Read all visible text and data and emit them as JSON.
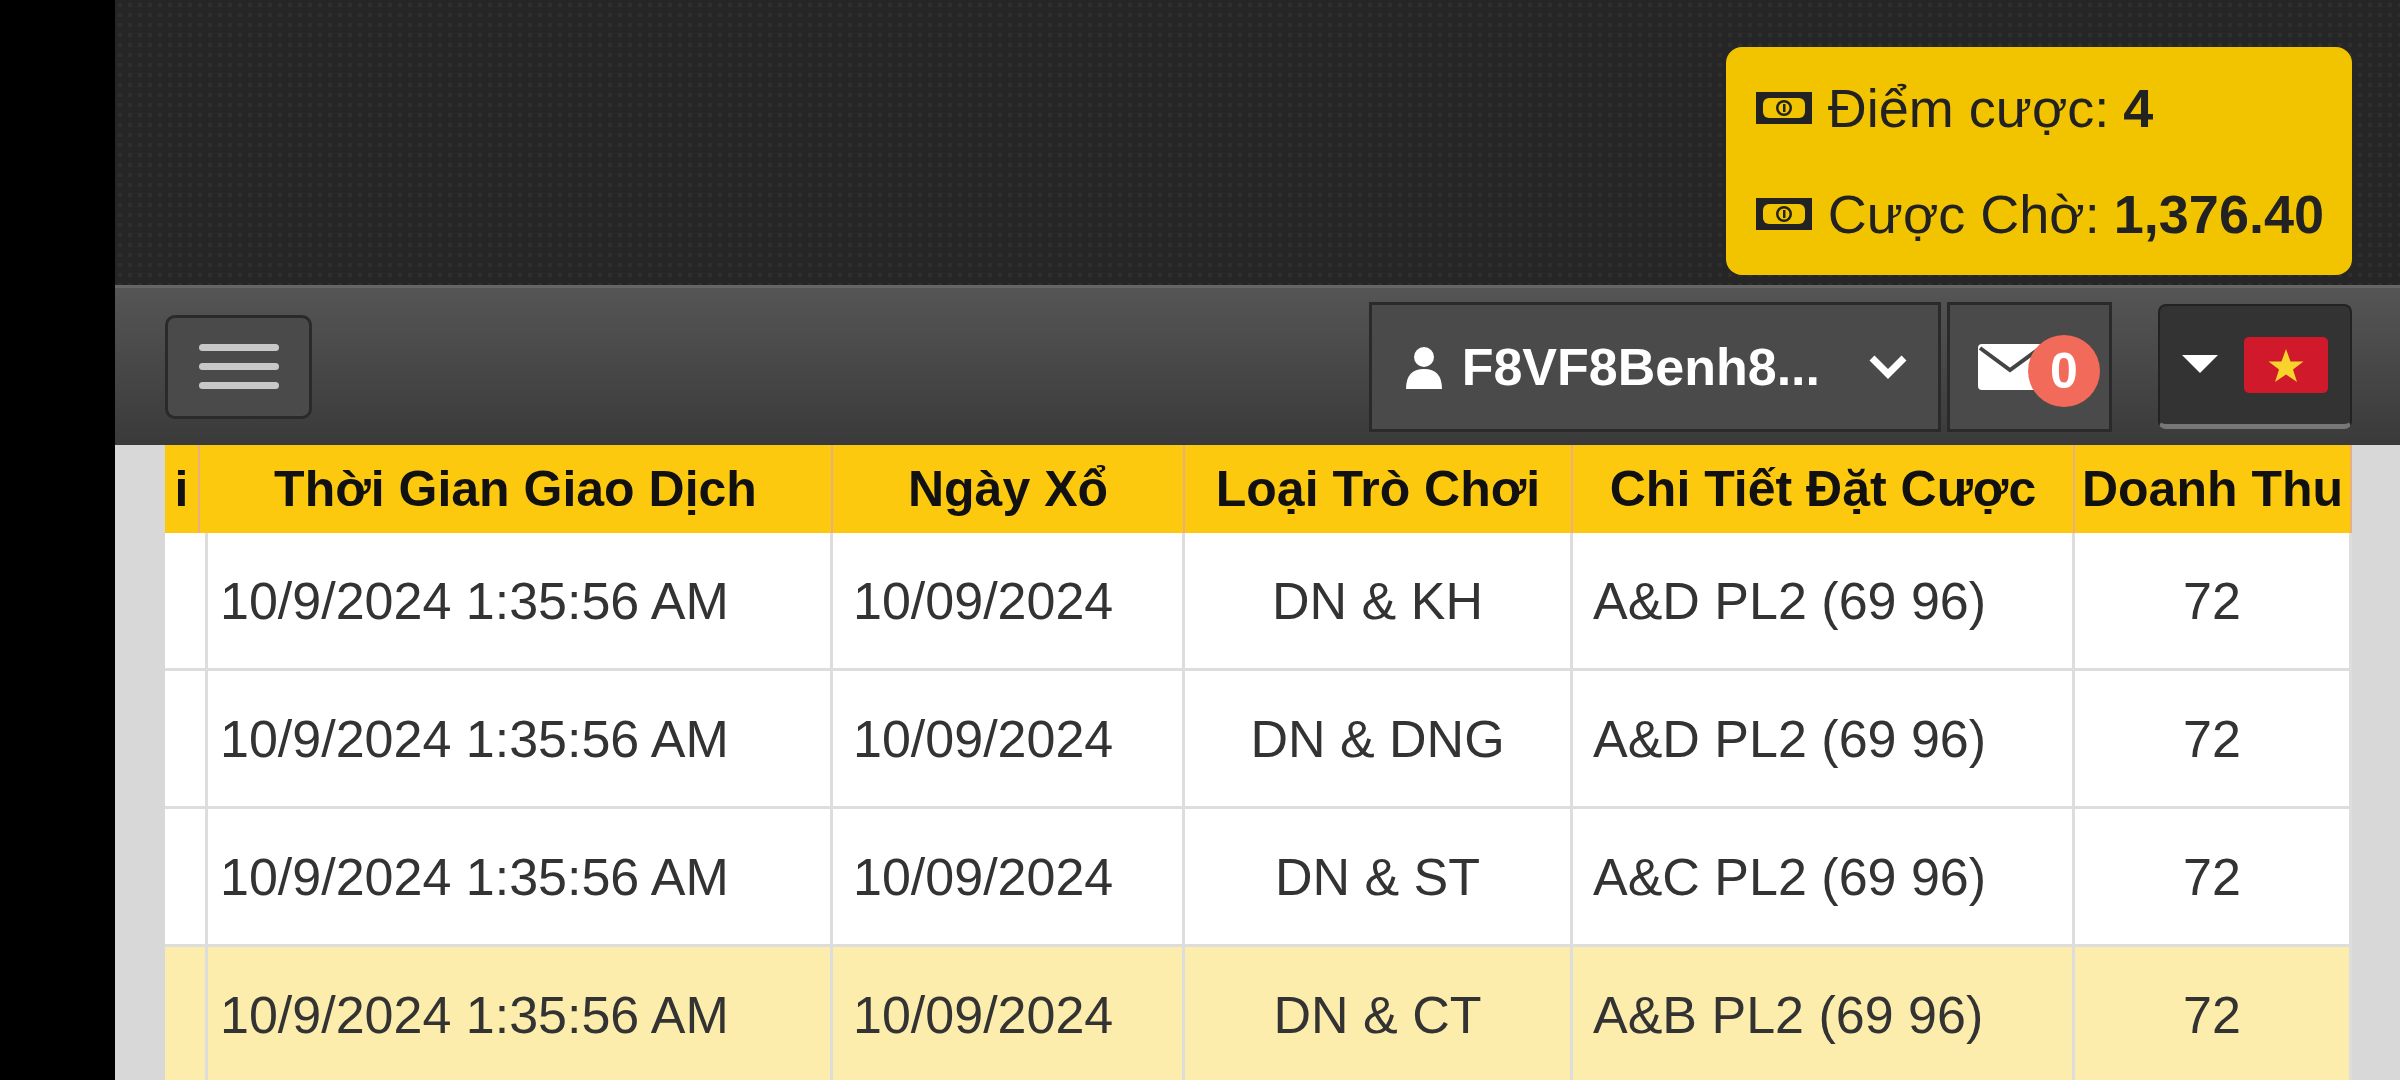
{
  "balance": {
    "items": [
      {
        "label": "Điểm cược:",
        "value": "4"
      },
      {
        "label": "Cược Chờ:",
        "value": "1,376.40"
      }
    ]
  },
  "navbar": {
    "username": "F8VF8Benh8...",
    "messages_count": "0"
  },
  "table": {
    "columns": [
      "i",
      "Thời Gian Giao Dịch",
      "Ngày Xổ",
      "Loại Trò Chơi",
      "Chi Tiết Đặt Cược",
      "Doanh Thu"
    ],
    "rows": [
      {
        "cells": [
          "",
          "10/9/2024 1:35:56 AM",
          "10/09/2024",
          "DN & KH",
          "A&D PL2 (69 96)",
          "72"
        ],
        "selected": false
      },
      {
        "cells": [
          "",
          "10/9/2024 1:35:56 AM",
          "10/09/2024",
          "DN & DNG",
          "A&D PL2 (69 96)",
          "72"
        ],
        "selected": false
      },
      {
        "cells": [
          "",
          "10/9/2024 1:35:56 AM",
          "10/09/2024",
          "DN & ST",
          "A&C PL2 (69 96)",
          "72"
        ],
        "selected": false
      },
      {
        "cells": [
          "",
          "10/9/2024 1:35:56 AM",
          "10/09/2024",
          "DN & CT",
          "A&B PL2 (69 96)",
          "72"
        ],
        "selected": true
      }
    ]
  }
}
